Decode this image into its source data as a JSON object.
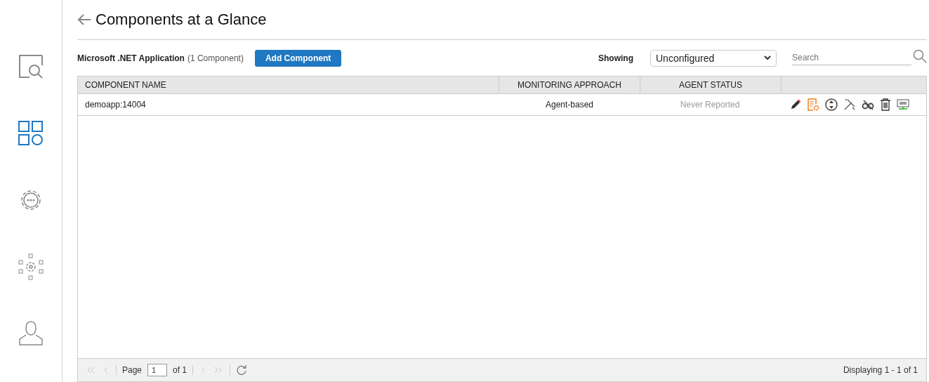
{
  "sidebar": {
    "items": [
      {
        "kind": "search",
        "selected": false
      },
      {
        "kind": "components",
        "selected": true
      },
      {
        "kind": "settings",
        "selected": false
      },
      {
        "kind": "topology",
        "selected": false
      },
      {
        "kind": "user",
        "selected": false
      }
    ]
  },
  "title": "Components at a Glance",
  "toolbar": {
    "app_name": "Microsoft .NET Application",
    "count": "(1 Component)",
    "add_button": "Add Component",
    "showing_label": "Showing",
    "showing_value": "Unconfigured",
    "search_placeholder": "Search"
  },
  "table": {
    "columns": [
      "COMPONENT NAME",
      "MONITORING APPROACH",
      "AGENT STATUS"
    ],
    "rows": [
      {
        "name": "demoapp:14004",
        "approach": "Agent-based",
        "status": "Never Reported"
      }
    ]
  },
  "pager": {
    "page_label": "Page",
    "page_value": "1",
    "of_label": "of 1",
    "nav_disabled": true,
    "display": "Displaying 1 - 1 of 1"
  }
}
